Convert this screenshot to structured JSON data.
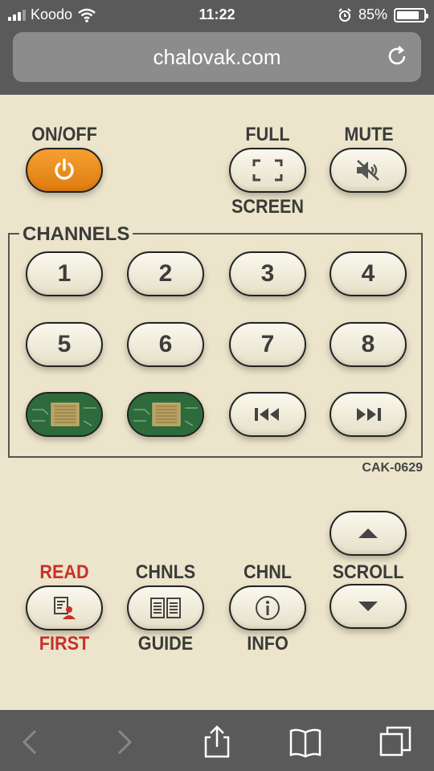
{
  "status": {
    "carrier": "Koodo",
    "time": "11:22",
    "battery_pct": "85%",
    "battery_level": 0.85
  },
  "browser": {
    "url": "chalovak.com"
  },
  "remote": {
    "on_off_label": "ON/OFF",
    "full_label_top": "FULL",
    "full_label_bottom": "SCREEN",
    "mute_label": "MUTE",
    "channels_title": "CHANNELS",
    "channel_buttons": [
      "1",
      "2",
      "3",
      "4",
      "5",
      "6",
      "7",
      "8"
    ],
    "model": "CAK-0629",
    "scroll_label": "SCROLL",
    "read_top": "READ",
    "read_bottom": "FIRST",
    "chnls_top": "CHNLS",
    "chnls_bottom": "GUIDE",
    "chnl_top": "CHNL",
    "chnl_bottom": "INFO"
  },
  "icons": {
    "power": "power-icon",
    "fullscreen": "fullscreen-icon",
    "mute": "mute-icon",
    "prev": "skip-back-icon",
    "next": "skip-forward-icon",
    "read": "document-person-icon",
    "guide": "book-guide-icon",
    "info": "info-icon",
    "up": "arrow-up-icon",
    "down": "arrow-down-icon"
  },
  "colors": {
    "accent_orange": "#e8861a",
    "label_red": "#c8312a",
    "panel_bg": "#ece5cb",
    "chrome_gray": "#5a5a5a"
  }
}
